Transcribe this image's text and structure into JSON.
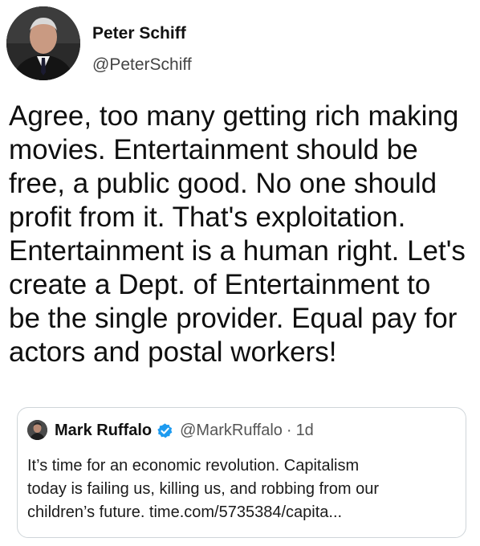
{
  "tweet": {
    "author": {
      "name": "Peter Schiff",
      "handle": "@PeterSchiff",
      "avatar_icon": "portrait-avatar"
    },
    "text_lines": [
      "Agree, too many getting rich making",
      "movies. Entertainment should be",
      "free, a public good. No one should",
      "profit from it. That's exploitation.",
      "Entertainment is a human right. Let's",
      "create a Dept. of Entertainment to",
      "be the single provider. Equal pay for",
      "actors and postal workers!"
    ],
    "quoted": {
      "author": {
        "name": "Mark Ruffalo",
        "handle": "@MarkRuffalo",
        "avatar_icon": "portrait-avatar",
        "verified_icon": "verified-badge-icon"
      },
      "separator": "·",
      "time": "1d",
      "text_lines": [
        "It’s time for an economic revolution. Capitalism",
        "today is failing us, killing us, and robbing from our",
        "children’s future. time.com/5735384/capita..."
      ]
    }
  },
  "colors": {
    "background": "#ffffff",
    "text": "#141414",
    "secondary_text": "#555555",
    "quote_border": "#cfd5d9",
    "verified_blue": "#1d9bf0"
  }
}
